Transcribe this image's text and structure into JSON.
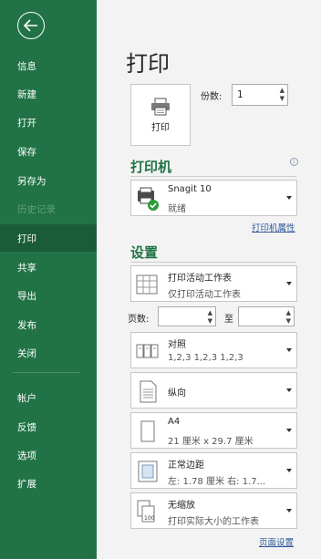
{
  "sidebar": {
    "back_label": "back",
    "items": [
      {
        "label": "信息",
        "state": "normal"
      },
      {
        "label": "新建",
        "state": "normal"
      },
      {
        "label": "打开",
        "state": "normal"
      },
      {
        "label": "保存",
        "state": "normal"
      },
      {
        "label": "另存为",
        "state": "normal"
      },
      {
        "label": "历史记录",
        "state": "disabled"
      },
      {
        "label": "打印",
        "state": "active"
      },
      {
        "label": "共享",
        "state": "normal"
      },
      {
        "label": "导出",
        "state": "normal"
      },
      {
        "label": "发布",
        "state": "normal"
      },
      {
        "label": "关闭",
        "state": "normal"
      },
      {
        "label": "帐户",
        "state": "normal"
      },
      {
        "label": "反馈",
        "state": "normal"
      },
      {
        "label": "选项",
        "state": "normal"
      },
      {
        "label": "扩展",
        "state": "normal"
      }
    ]
  },
  "main": {
    "title": "打印",
    "print_button_label": "打印",
    "copies_label": "份数:",
    "copies_value": "1",
    "printer_section_title": "打印机",
    "printer": {
      "name": "Snagit 10",
      "status": "就绪"
    },
    "printer_properties_link": "打印机属性",
    "settings_section_title": "设置",
    "scope": {
      "title": "打印活动工作表",
      "sub": "仅打印活动工作表"
    },
    "pages_label": "页数:",
    "pages_from": "",
    "to_label": "至",
    "pages_to": "",
    "collate": {
      "title": "对照",
      "sub": "1,2,3    1,2,3    1,2,3"
    },
    "orientation": {
      "title": "纵向"
    },
    "paper": {
      "title": "A4",
      "sub": "21 厘米 x 29.7 厘米"
    },
    "margins": {
      "title": "正常边距",
      "sub": "左: 1.78 厘米    右: 1.7..."
    },
    "scaling": {
      "title": "无缩放",
      "sub": "打印实际大小的工作表"
    },
    "page_setup_link": "页面设置"
  },
  "colors": {
    "accent": "#217346",
    "sidebar_active": "#1a5c37",
    "link": "#2b579a"
  }
}
